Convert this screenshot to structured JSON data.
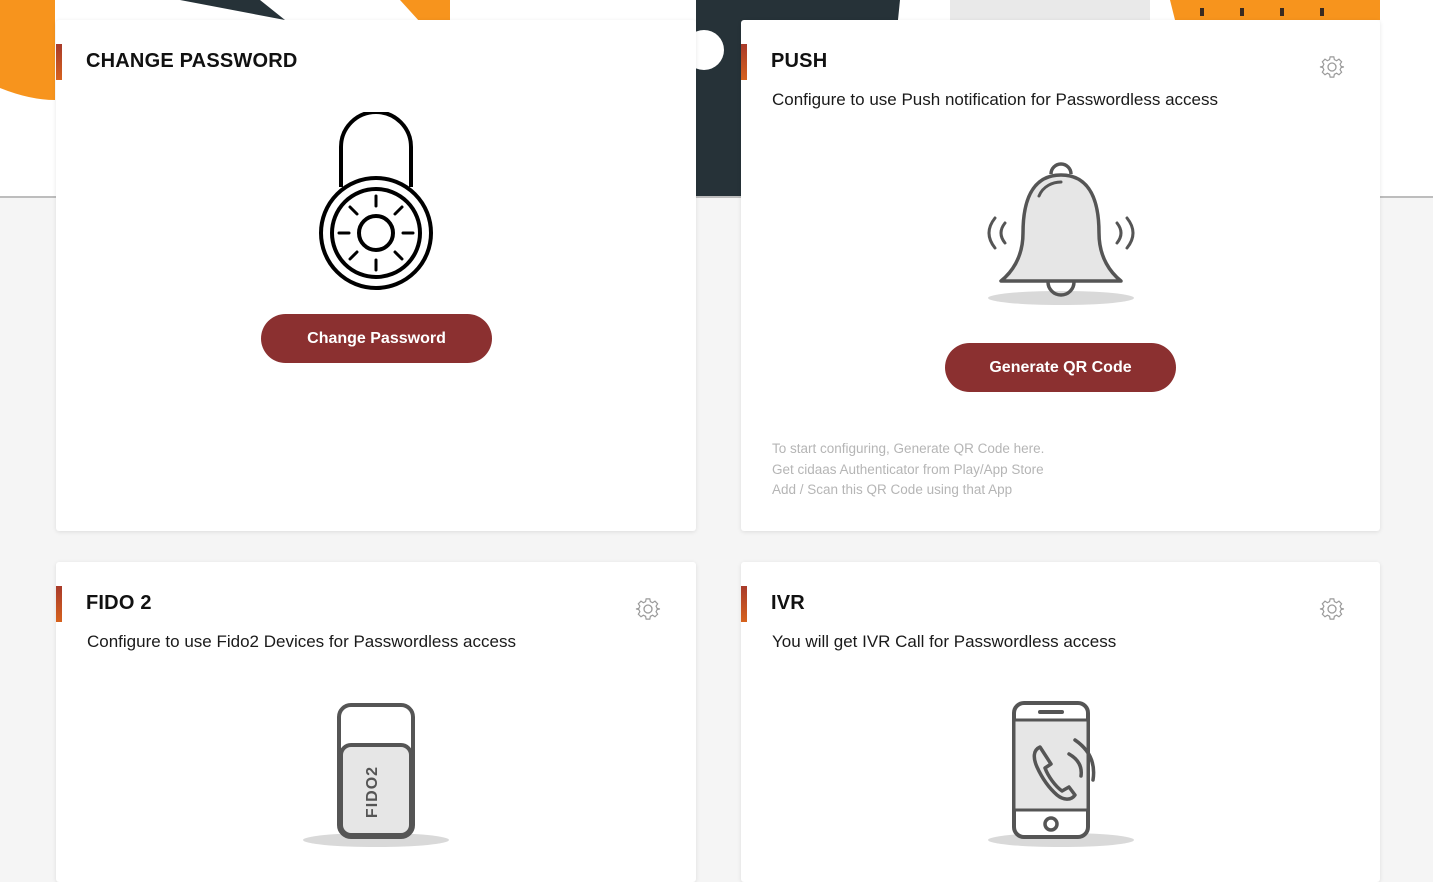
{
  "cards": {
    "change_password": {
      "title": "CHANGE PASSWORD",
      "button_label": "Change Password",
      "icon": "combination-lock-icon"
    },
    "push": {
      "title": "PUSH",
      "description": "Configure to use Push notification for Passwordless access",
      "button_label": "Generate QR Code",
      "icon": "bell-icon",
      "settings_icon": "gear-icon",
      "hints": [
        "To start configuring, Generate QR Code here.",
        "Get cidaas Authenticator from Play/App Store",
        "Add / Scan this QR Code using that App"
      ]
    },
    "fido2": {
      "title": "FIDO 2",
      "description": "Configure to use Fido2 Devices for Passwordless access",
      "icon": "usb-key-icon",
      "key_label": "FIDO2",
      "settings_icon": "gear-icon"
    },
    "ivr": {
      "title": "IVR",
      "description": "You will get IVR Call for Passwordless access",
      "icon": "phone-call-icon",
      "settings_icon": "gear-icon"
    }
  },
  "colors": {
    "primary_button": "#8b3030",
    "accent_top": "#a83a2a",
    "accent_bottom": "#d6621e",
    "banner_orange": "#f7941d",
    "banner_dark": "#263238",
    "hint_text": "#b5b5b5"
  }
}
